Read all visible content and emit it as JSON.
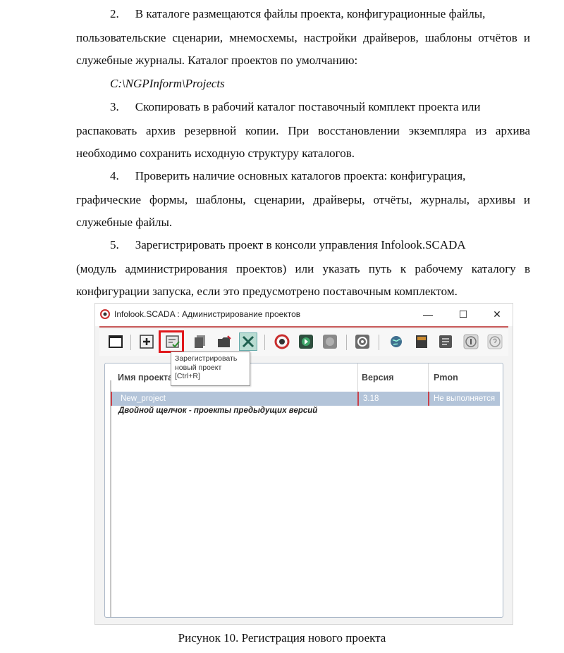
{
  "document": {
    "paragraphs": [
      {
        "num": "2.",
        "first": "В каталоге размещаются файлы проекта, конфигурационные файлы,",
        "rest": "пользовательские сценарии, мнемосхемы, настройки драйверов, шаблоны отчётов и служебные журналы. Каталог проектов по умолчанию:"
      },
      {
        "path": "C:\\NGPInform\\Projects"
      },
      {
        "num": "3.",
        "first": "Скопировать в рабочий каталог поставочный комплект проекта или",
        "rest": "распаковать архив резервной копии. При восстановлении экземпляра из архива необходимо сохранить исходную структуру каталогов."
      },
      {
        "num": "4.",
        "first": "Проверить наличие основных каталогов проекта: конфигурация,",
        "rest": "графические формы, шаблоны, сценарии, драйверы, отчёты, журналы, архивы и служебные файлы."
      },
      {
        "num": "5.",
        "first": "Зарегистрировать проект в консоли управления Infolook.SCADA",
        "rest": "(модуль администрирования проектов) или указать путь к рабочему каталогу в конфигурации запуска, если это предусмотрено поставочным комплектом."
      }
    ],
    "caption": "Рисунок 10. Регистрация нового проекта"
  },
  "window": {
    "title": "Infolook.SCADA : Администрирование проектов",
    "minimize": "—",
    "maximize": "☐",
    "close": "✕",
    "accent_color": "#c85a5a"
  },
  "toolbar": {
    "buttons": [
      "window-icon",
      "add-icon",
      "register-project-icon",
      "copy-icon",
      "folder-icon",
      "tools-icon",
      "scada-logo-icon",
      "play-icon",
      "stop-icon",
      "sync-icon",
      "globe-icon",
      "archive-icon",
      "document-icon",
      "info-icon",
      "help-icon"
    ],
    "highlight_color": "#e0171b",
    "tooltip": [
      "Зарегистрировать",
      "новый проект",
      "[Ctrl+R]"
    ]
  },
  "grid": {
    "columns": [
      "Имя проекта",
      "Версия",
      "Pmon"
    ],
    "rows": [
      {
        "name": "New_project",
        "version": "3.18",
        "pmon": "Не выполняется"
      }
    ],
    "hint": "Двойной щелчок - проекты предыдущих версий",
    "selected_color": "#b3c4d9"
  }
}
